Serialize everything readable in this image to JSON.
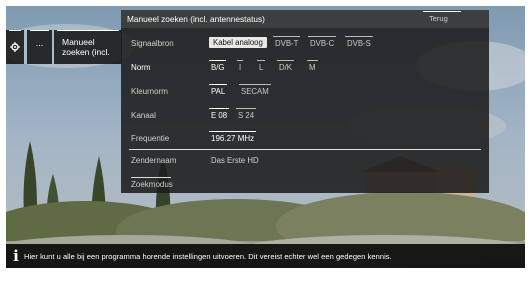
{
  "left_tiles": {
    "gear_icon": "gear-icon",
    "more_label": "...",
    "manual_label_line1": "Manueel",
    "manual_label_line2": "zoeken (incl."
  },
  "panel": {
    "title": "Manueel zoeken (incl. antennestatus)",
    "back_label": "Terug",
    "rows": {
      "signal": {
        "label": "Signaalbron",
        "options": [
          "Kabel analoog",
          "DVB-T",
          "DVB-C",
          "DVB-S"
        ],
        "selected": "Kabel analoog"
      },
      "norm": {
        "label": "Norm",
        "options": [
          "B/G",
          "I",
          "L",
          "D/K",
          "M"
        ],
        "selected": "B/G"
      },
      "colornorm": {
        "label": "Kleurnorm",
        "options": [
          "PAL",
          "SECAM"
        ],
        "selected": "PAL"
      },
      "channel": {
        "label": "Kanaal",
        "options": [
          "E 08",
          "S 24"
        ],
        "selected": "E 08"
      },
      "frequency": {
        "label": "Frequentie",
        "value": "196.27 MHz"
      },
      "station": {
        "label": "Zendernaam",
        "value": "Das Erste  HD"
      }
    },
    "footer_tab": "Zoekmodus"
  },
  "info_bar": {
    "icon": "info-icon",
    "text": "Hier kunt u alle bij een programma horende instellingen uitvoeren. Dit vereist echter wel een gedegen kennis."
  },
  "colors": {
    "panel_bg": "#1c1c1c",
    "selected_box": "#e8e8e8",
    "text": "#ffffff"
  }
}
